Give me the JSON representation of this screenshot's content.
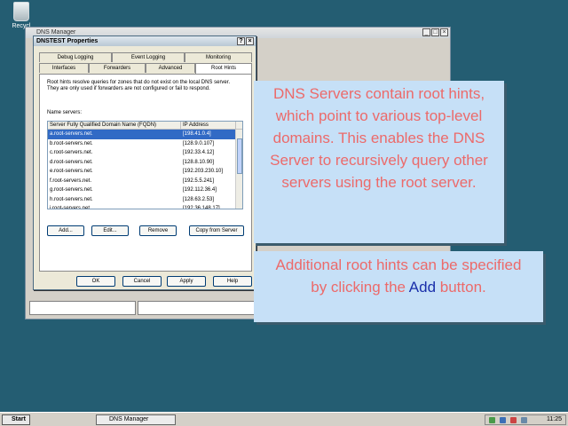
{
  "desktop": {
    "recycle_label": "Recycl"
  },
  "manager_window": {
    "title": "DNS Manager"
  },
  "dialog": {
    "title": "DNSTEST Properties",
    "tabs_row1": [
      "Debug Logging",
      "Event Logging",
      "Monitoring"
    ],
    "tabs_row2": [
      "Interfaces",
      "Forwarders",
      "Advanced",
      "Root Hints"
    ],
    "active_tab": "Root Hints",
    "description": "Root hints resolve queries for zones that do not exist on the local DNS server. They are only used if forwarders are not configured or fail to respond.",
    "name_servers_label": "Name servers:",
    "columns": [
      "Server Fully Qualified Domain Name (FQDN)",
      "IP Address"
    ],
    "rows": [
      {
        "fqdn": "a.root-servers.net.",
        "ip": "[198.41.0.4]"
      },
      {
        "fqdn": "b.root-servers.net.",
        "ip": "[128.9.0.107]"
      },
      {
        "fqdn": "c.root-servers.net.",
        "ip": "[192.33.4.12]"
      },
      {
        "fqdn": "d.root-servers.net.",
        "ip": "[128.8.10.90]"
      },
      {
        "fqdn": "e.root-servers.net.",
        "ip": "[192.203.230.10]"
      },
      {
        "fqdn": "f.root-servers.net.",
        "ip": "[192.5.5.241]"
      },
      {
        "fqdn": "g.root-servers.net.",
        "ip": "[192.112.36.4]"
      },
      {
        "fqdn": "h.root-servers.net.",
        "ip": "[128.63.2.53]"
      },
      {
        "fqdn": "i.root-servers.net.",
        "ip": "[192.36.148.17]"
      }
    ],
    "buttons": {
      "add": "Add...",
      "edit": "Edit...",
      "remove": "Remove",
      "copy": "Copy from Server"
    },
    "footer": {
      "ok": "OK",
      "cancel": "Cancel",
      "apply": "Apply",
      "help": "Help"
    }
  },
  "callouts": {
    "first": "DNS Servers contain root hints, which point to various top-level domains. This enables the DNS Server to recursively query other servers using the root server.",
    "second_before": "Additional root hints can be specified by clicking the ",
    "second_highlight": "Add",
    "second_after": " button."
  },
  "taskbar": {
    "start": "Start",
    "task": "DNS Manager",
    "clock": "11:25"
  },
  "colors": {
    "callout_bg": "#c6e0f7",
    "callout_text": "#ec6a6a",
    "highlight": "#1a2faa",
    "desktop": "#245d72"
  }
}
